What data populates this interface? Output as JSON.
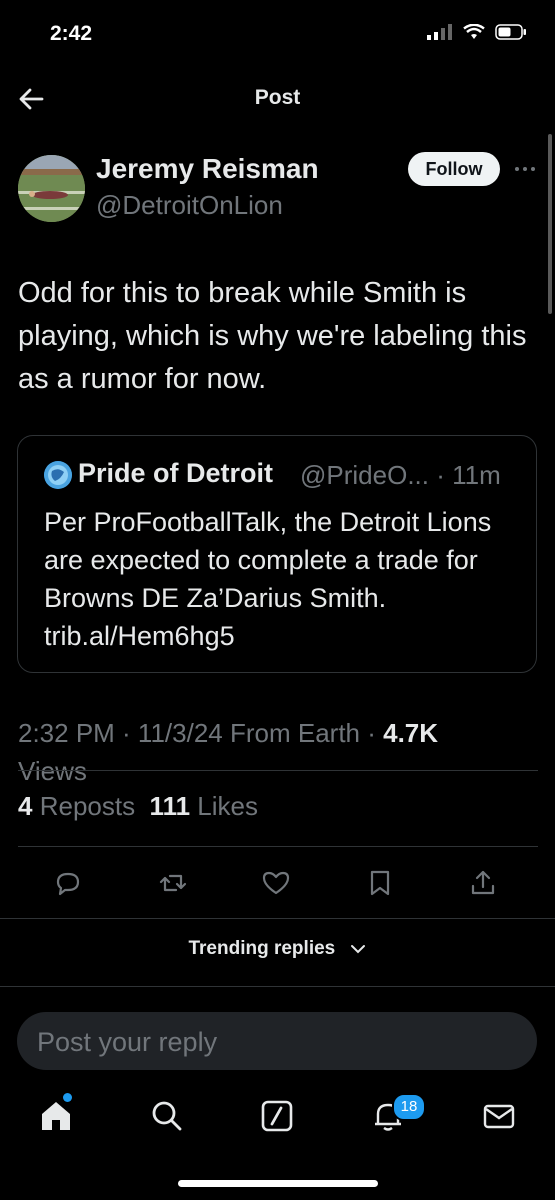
{
  "status": {
    "time": "2:42"
  },
  "header": {
    "title": "Post"
  },
  "author": {
    "name": "Jeremy Reisman",
    "handle": "@DetroitOnLion",
    "follow_label": "Follow"
  },
  "post": {
    "text": "Odd for this to break while Smith is playing, which is why we're labeling this as a rumor for now."
  },
  "quote": {
    "name": "Pride of Detroit",
    "meta": "@PrideO... · 11m",
    "text": "Per ProFootballTalk, the Detroit Lions are expected to complete a trade for Browns DE Za’Darius Smith. trib.al/Hem6hg5"
  },
  "meta": {
    "timestamp": "2:32 PM · 11/3/24 From Earth · ",
    "views_count": "4.7K",
    "views_label": "Views"
  },
  "stats": {
    "reposts_count": "4",
    "reposts_label": "Reposts",
    "likes_count": "111",
    "likes_label": "Likes"
  },
  "trending": {
    "label": "Trending replies"
  },
  "reply": {
    "placeholder": "Post your reply"
  },
  "tabbar": {
    "notifications_badge": "18"
  },
  "colors": {
    "accent": "#1d9bf0",
    "background": "#000000",
    "muted": "#71767b"
  }
}
